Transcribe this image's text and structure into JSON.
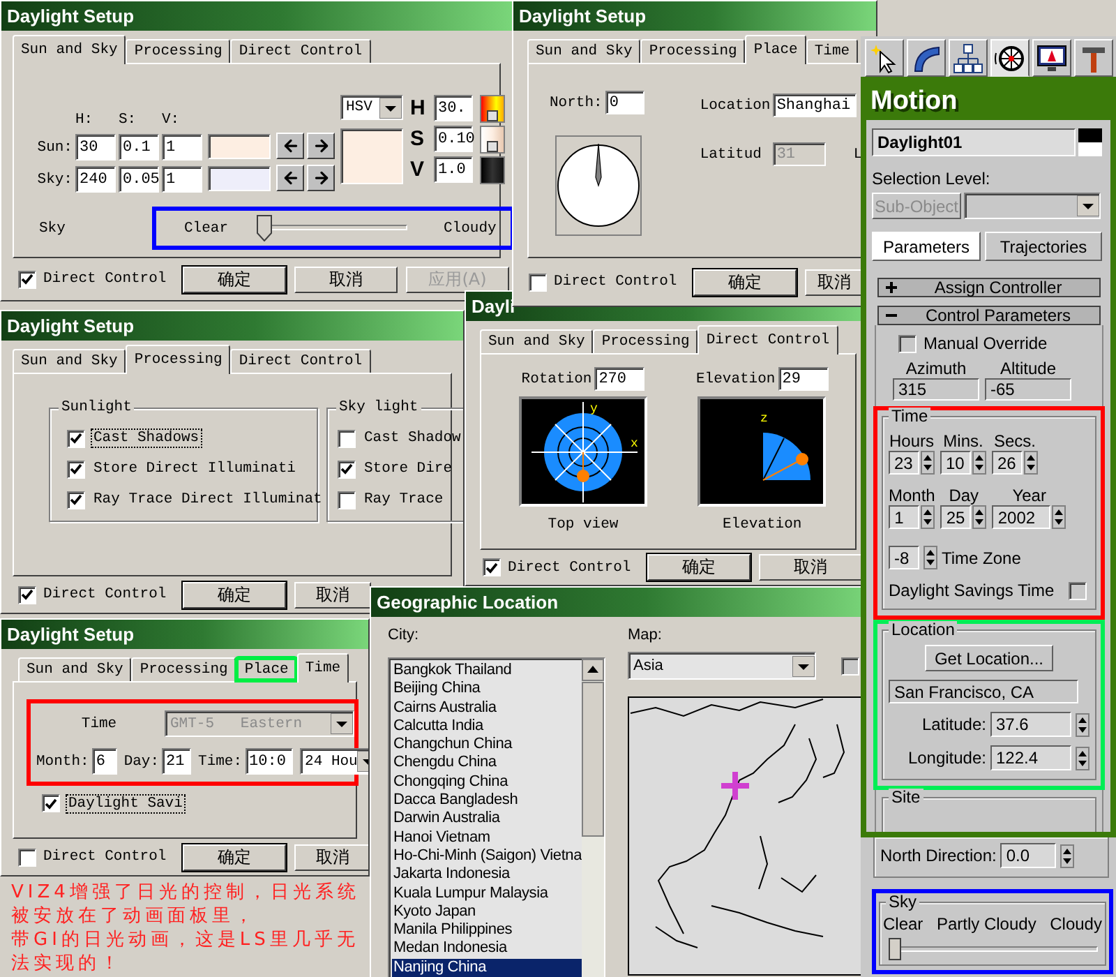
{
  "dialog_sun_sky": {
    "title": "Daylight Setup",
    "tabs": [
      {
        "label": "Sun and Sky",
        "selected": true
      },
      {
        "label": "Processing",
        "selected": false
      },
      {
        "label": "Direct Control",
        "selected": false
      }
    ],
    "color_headers": [
      "H:",
      "S:",
      "V:"
    ],
    "color_rows": [
      {
        "label": "Sun:",
        "values": [
          "30",
          "0.1",
          "1"
        ]
      },
      {
        "label": "Sky:",
        "values": [
          "240",
          "0.05",
          "1"
        ]
      }
    ],
    "mode": "HSV",
    "hsv_fields": [
      {
        "label": "H",
        "value": "30."
      },
      {
        "label": "S",
        "value": "0.10"
      },
      {
        "label": "V",
        "value": "1.0"
      }
    ],
    "sky": {
      "label": "Sky",
      "left": "Clear",
      "right": "Cloudy",
      "level": 0
    },
    "footer": {
      "checkbox": {
        "label": "Direct Control",
        "checked": true
      },
      "buttons": [
        {
          "label": "确定",
          "disabled": false
        },
        {
          "label": "取消",
          "disabled": false
        },
        {
          "label": "应用(A)",
          "disabled": true
        }
      ]
    }
  },
  "dialog_place": {
    "title": "Daylight Setup",
    "tabs": [
      {
        "label": "Sun and Sky",
        "selected": false
      },
      {
        "label": "Processing",
        "selected": false
      },
      {
        "label": "Place",
        "selected": true
      },
      {
        "label": "Time",
        "selected": false
      }
    ],
    "north": {
      "label": "North:",
      "value": "0"
    },
    "location": {
      "label": "Location",
      "value": "Shanghai"
    },
    "latitude": {
      "label": "Latitud",
      "value": "31",
      "disabled": true
    },
    "longitude_label": "L",
    "footer": {
      "checkbox": {
        "label": "Direct Control",
        "checked": false
      },
      "buttons": [
        {
          "label": "确定",
          "disabled": false
        },
        {
          "label": "取消",
          "disabled": false
        }
      ]
    }
  },
  "dialog_processing": {
    "title": "Daylight Setup",
    "tabs": [
      {
        "label": "Sun and Sky",
        "selected": false
      },
      {
        "label": "Processing",
        "selected": true
      },
      {
        "label": "Direct Control",
        "selected": false
      }
    ],
    "groups": [
      {
        "title": "Sunlight",
        "items": [
          {
            "label": "Cast Shadows",
            "checked": true,
            "focused": true
          },
          {
            "label": "Store Direct Illuminati",
            "checked": true,
            "focused": false
          },
          {
            "label": "Ray Trace Direct Illuminat",
            "checked": true,
            "focused": false
          }
        ]
      },
      {
        "title": "Sky light",
        "items": [
          {
            "label": "Cast Shadow",
            "checked": false,
            "focused": false
          },
          {
            "label": "Store Dire",
            "checked": true,
            "focused": false
          },
          {
            "label": "Ray Trace",
            "checked": false,
            "focused": false
          }
        ]
      }
    ],
    "footer": {
      "checkbox": {
        "label": "Direct Control",
        "checked": true
      },
      "buttons": [
        {
          "label": "确定",
          "disabled": false
        },
        {
          "label": "取消",
          "disabled": false
        }
      ]
    }
  },
  "dialog_direct": {
    "title": "Dayli",
    "tabs": [
      {
        "label": "Sun and Sky",
        "selected": false
      },
      {
        "label": "Processing",
        "selected": false
      },
      {
        "label": "Direct Control",
        "selected": true
      }
    ],
    "views": [
      {
        "kind": "top",
        "label": "Rotation",
        "value": "270",
        "caption": "Top view",
        "axes": [
          "y",
          "x"
        ]
      },
      {
        "kind": "side",
        "label": "Elevation",
        "value": "29",
        "caption": "Elevation",
        "axes": [
          "z"
        ]
      }
    ],
    "footer": {
      "checkbox": {
        "label": "Direct Control",
        "checked": true
      },
      "buttons": [
        {
          "label": "确定",
          "disabled": false
        },
        {
          "label": "取消",
          "disabled": false
        }
      ]
    }
  },
  "dialog_time": {
    "title": "Daylight Setup",
    "tabs": [
      {
        "label": "Sun and Sky",
        "selected": false,
        "highlighted": false
      },
      {
        "label": "Processing",
        "selected": false,
        "highlighted": false
      },
      {
        "label": "Place",
        "selected": false,
        "highlighted": true
      },
      {
        "label": "Time",
        "selected": true,
        "highlighted": false
      }
    ],
    "time_zone": {
      "label": "Time",
      "value": "GMT-5   Eastern",
      "disabled": true
    },
    "fields": [
      {
        "label": "Month:",
        "value": "6"
      },
      {
        "label": "Day:",
        "value": "21"
      },
      {
        "label": "Time:",
        "value": "10:0"
      }
    ],
    "clock_mode": "24 Hou",
    "daylight_saving": {
      "label": "Daylight Savi",
      "checked": true
    },
    "footer": {
      "checkbox": {
        "label": "Direct Control",
        "checked": false
      },
      "buttons": [
        {
          "label": "确定",
          "disabled": false
        },
        {
          "label": "取消",
          "disabled": false
        }
      ]
    }
  },
  "geographic_location": {
    "title": "Geographic Location",
    "city_label": "City:",
    "cities": [
      {
        "name": "Bangkok Thailand",
        "selected": false
      },
      {
        "name": "Beijing China",
        "selected": false
      },
      {
        "name": "Cairns Australia",
        "selected": false
      },
      {
        "name": "Calcutta India",
        "selected": false
      },
      {
        "name": "Changchun China",
        "selected": false
      },
      {
        "name": "Chengdu China",
        "selected": false
      },
      {
        "name": "Chongqing China",
        "selected": false
      },
      {
        "name": "Dacca Bangladesh",
        "selected": false
      },
      {
        "name": "Darwin Australia",
        "selected": false
      },
      {
        "name": "Hanoi Vietnam",
        "selected": false
      },
      {
        "name": "Ho-Chi-Minh (Saigon) Vietna",
        "selected": false
      },
      {
        "name": "Jakarta Indonesia",
        "selected": false
      },
      {
        "name": "Kuala Lumpur Malaysia",
        "selected": false
      },
      {
        "name": "Kyoto Japan",
        "selected": false
      },
      {
        "name": "Manila Philippines",
        "selected": false
      },
      {
        "name": "Medan Indonesia",
        "selected": false
      },
      {
        "name": "Nanjing China",
        "selected": true
      }
    ],
    "map_label": "Map:",
    "region": "Asia",
    "option_checked": false
  },
  "motion_panel": {
    "tabs": [
      {
        "kind": "create",
        "selected": false
      },
      {
        "kind": "modify",
        "selected": false
      },
      {
        "kind": "hierarchy",
        "selected": false
      },
      {
        "kind": "motion",
        "selected": true
      },
      {
        "kind": "display",
        "selected": false
      },
      {
        "kind": "utilities",
        "selected": false
      }
    ],
    "heading": "Motion",
    "object_name": "Daylight01",
    "selection_level_label": "Selection Level:",
    "sub_object": {
      "label": "Sub-Object",
      "disabled": true
    },
    "subtabs": [
      {
        "label": "Parameters",
        "selected": true
      },
      {
        "label": "Trajectories",
        "selected": false
      }
    ],
    "rollouts": [
      {
        "label": "Assign Controller",
        "expanded": false
      },
      {
        "label": "Control Parameters",
        "expanded": true
      }
    ],
    "manual_override": {
      "label": "Manual Override",
      "checked": false
    },
    "angles": [
      {
        "label": "Azimuth",
        "value": "315"
      },
      {
        "label": "Altitude",
        "value": "-65"
      }
    ],
    "time_group": {
      "title": "Time",
      "clock": [
        {
          "label": "Hours",
          "value": "23"
        },
        {
          "label": "Mins.",
          "value": "10"
        },
        {
          "label": "Secs.",
          "value": "26"
        }
      ],
      "date": [
        {
          "label": "Month",
          "value": "1"
        },
        {
          "label": "Day",
          "value": "25"
        },
        {
          "label": "Year",
          "value": "2002"
        }
      ],
      "time_zone": {
        "label": "Time Zone",
        "value": "-8"
      },
      "daylight_saving": {
        "label": "Daylight Savings Time",
        "checked": false
      }
    },
    "location_group": {
      "title": "Location",
      "button": "Get Location...",
      "place": "San Francisco, CA",
      "coords": [
        {
          "label": "Latitude:",
          "value": "37.6"
        },
        {
          "label": "Longitude:",
          "value": "122.4"
        }
      ]
    },
    "site_group": {
      "title": "Site",
      "north": {
        "label": "North Direction:",
        "value": "0.0"
      }
    },
    "sky_group": {
      "title": "Sky",
      "labels": [
        "Clear",
        "Partly Cloudy",
        "Cloudy"
      ],
      "level": 0
    }
  },
  "caption": [
    "VIZ4增强了日光的控制，日光系统被安放在了动画面板里，",
    "带GI的日光动画，这是LS里几乎无法实现的！"
  ]
}
